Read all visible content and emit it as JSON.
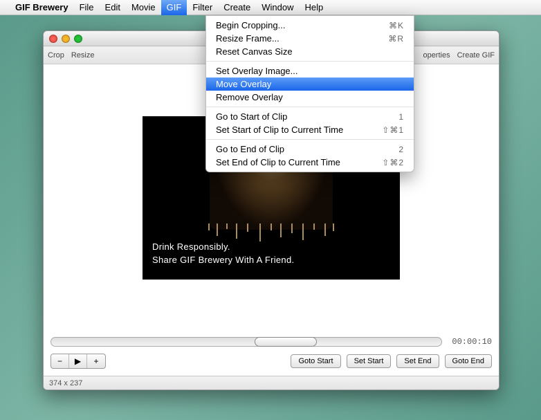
{
  "menubar": {
    "app": "GIF Brewery",
    "items": [
      "File",
      "Edit",
      "Movie",
      "GIF",
      "Filter",
      "Create",
      "Window",
      "Help"
    ],
    "active_index": 3
  },
  "dropdown": {
    "groups": [
      [
        {
          "label": "Begin Cropping...",
          "shortcut": "⌘K"
        },
        {
          "label": "Resize Frame...",
          "shortcut": "⌘R"
        },
        {
          "label": "Reset Canvas Size",
          "shortcut": ""
        }
      ],
      [
        {
          "label": "Set Overlay Image...",
          "shortcut": ""
        },
        {
          "label": "Move Overlay",
          "shortcut": "",
          "highlighted": true
        },
        {
          "label": "Remove Overlay",
          "shortcut": ""
        }
      ],
      [
        {
          "label": "Go to Start of Clip",
          "shortcut": "1"
        },
        {
          "label": "Set Start of Clip to Current Time",
          "shortcut": "⇧⌘1"
        }
      ],
      [
        {
          "label": "Go to End of Clip",
          "shortcut": "2"
        },
        {
          "label": "Set End of Clip to Current Time",
          "shortcut": "⇧⌘2"
        }
      ]
    ]
  },
  "window": {
    "toolbar_left": [
      "Crop",
      "Resize"
    ],
    "toolbar_right": [
      "operties",
      "Create GIF"
    ],
    "canvas": {
      "overlay_line1": "Drink Responsibly.",
      "overlay_line2": "Share GIF Brewery With A Friend."
    },
    "timecode": "00:00:10",
    "segmented": {
      "minus": "−",
      "play": "▶",
      "plus": "+"
    },
    "buttons": {
      "goto_start": "Goto Start",
      "set_start": "Set Start",
      "set_end": "Set End",
      "goto_end": "Goto End"
    },
    "status": "374 x 237"
  }
}
